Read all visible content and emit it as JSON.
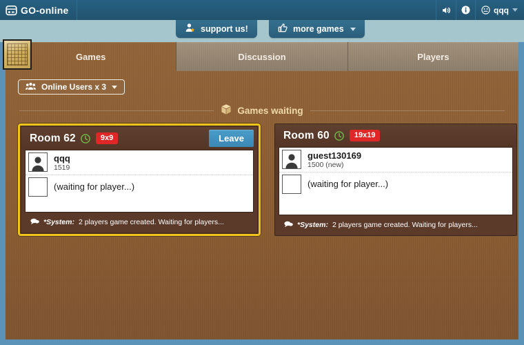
{
  "topbar": {
    "logo_text": "GO-online",
    "logo_icon": "go-board-logo-icon",
    "sound_icon": "speaker-icon",
    "info_icon": "info-icon",
    "user_icon": "smiley-icon",
    "user_name": "qqq",
    "caret_icon": "chevron-down-icon",
    "brand_color": "#245a7c"
  },
  "promo": {
    "support_label": "support us!",
    "support_icon": "user-star-icon",
    "more_games_label": "more games",
    "more_games_icon": "thumbs-up-icon"
  },
  "board_badge_icon": "go-board-icon",
  "tabs": [
    {
      "label": "Games",
      "active": true
    },
    {
      "label": "Discussion",
      "active": false
    },
    {
      "label": "Players",
      "active": false
    }
  ],
  "toolbar": {
    "online_users_label": "Online Users x 3",
    "online_users_icon": "users-group-icon"
  },
  "section": {
    "games_waiting_label": "Games waiting",
    "games_waiting_icon": "box-icon",
    "games_waiting_color": "#efd9a8"
  },
  "rooms": [
    {
      "title": "Room 62",
      "clock_icon": "clock-icon",
      "size_badge": "9x9",
      "size_badge_color": "#e02727",
      "highlighted": true,
      "highlight_color": "#f0c419",
      "leave_label": "Leave",
      "has_leave_button": true,
      "players": [
        {
          "name": "qqq",
          "rating": "1519",
          "occupied": true,
          "avatar_icon": "user-avatar-icon"
        },
        {
          "name": "(waiting for player...)",
          "rating": "",
          "occupied": false,
          "avatar_icon": "empty-seat-icon"
        }
      ],
      "system_icon": "chat-bubble-icon",
      "system_label": "*System:",
      "system_text": "2 players game created. Waiting for players..."
    },
    {
      "title": "Room 60",
      "clock_icon": "clock-icon",
      "size_badge": "19x19",
      "size_badge_color": "#e02727",
      "highlighted": false,
      "highlight_color": "",
      "leave_label": "",
      "has_leave_button": false,
      "players": [
        {
          "name": "guest130169",
          "rating": "1500 (new)",
          "occupied": true,
          "avatar_icon": "user-avatar-icon"
        },
        {
          "name": "(waiting for player...)",
          "rating": "",
          "occupied": false,
          "avatar_icon": "empty-seat-icon"
        }
      ],
      "system_icon": "chat-bubble-icon",
      "system_label": "*System:",
      "system_text": "2 players game created. Waiting for players..."
    }
  ]
}
